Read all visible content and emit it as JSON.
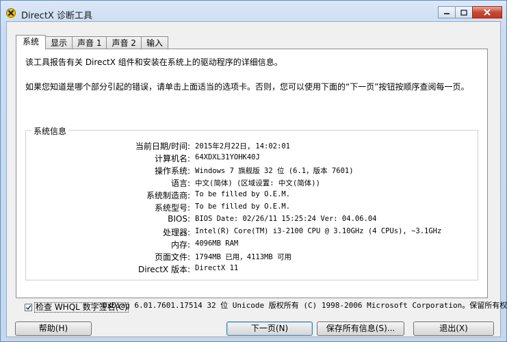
{
  "window": {
    "title": "DirectX 诊断工具"
  },
  "tabs": [
    {
      "label": "系统",
      "active": true
    },
    {
      "label": "显示",
      "active": false
    },
    {
      "label": "声音 1",
      "active": false
    },
    {
      "label": "声音 2",
      "active": false
    },
    {
      "label": "输入",
      "active": false
    }
  ],
  "intro": {
    "line1": "该工具报告有关 DirectX 组件和安装在系统上的驱动程序的详细信息。",
    "line2": "如果您知道是哪个部分引起的错误，请单击上面适当的选项卡。否则，您可以使用下面的“下一页”按钮按顺序查阅每一页。"
  },
  "system_info": {
    "legend": "系统信息",
    "rows": [
      {
        "label": "当前日期/时间:",
        "value": "2015年2月22日, 14:02:01"
      },
      {
        "label": "计算机名:",
        "value": "64XDXL31YOHK40J"
      },
      {
        "label": "操作系统:",
        "value": "Windows 7 旗舰版 32 位 (6.1，版本 7601)"
      },
      {
        "label": "语言:",
        "value": "中文(简体) (区域设置: 中文(简体))"
      },
      {
        "label": "系统制造商:",
        "value": "To be filled by O.E.M."
      },
      {
        "label": "系统型号:",
        "value": "To be filled by O.E.M."
      },
      {
        "label": "BIOS:",
        "value": "BIOS Date: 02/26/11 15:25:24 Ver: 04.06.04"
      },
      {
        "label": "处理器:",
        "value": "Intel(R) Core(TM) i3-2100 CPU @ 3.10GHz (4 CPUs), ~3.1GHz"
      },
      {
        "label": "内存:",
        "value": "4096MB RAM"
      },
      {
        "label": "页面文件:",
        "value": "1794MB 已用，4113MB 可用"
      },
      {
        "label": "DirectX 版本:",
        "value": "DirectX 11"
      }
    ]
  },
  "whql": {
    "label": "检查 WHQL 数字签名(C)",
    "checked": true
  },
  "footer": {
    "copyright": "DxDiag 6.01.7601.17514 32 位 Unicode 版权所有 (C) 1998-2006 Microsoft Corporation。保留所有权"
  },
  "buttons": {
    "help": "帮助(H)",
    "next": "下一页(N)",
    "save": "保存所有信息(S)...",
    "exit": "退出(X)"
  },
  "colors": {
    "close_red": "#c9462f",
    "icon_yellow": "#f2c200"
  }
}
